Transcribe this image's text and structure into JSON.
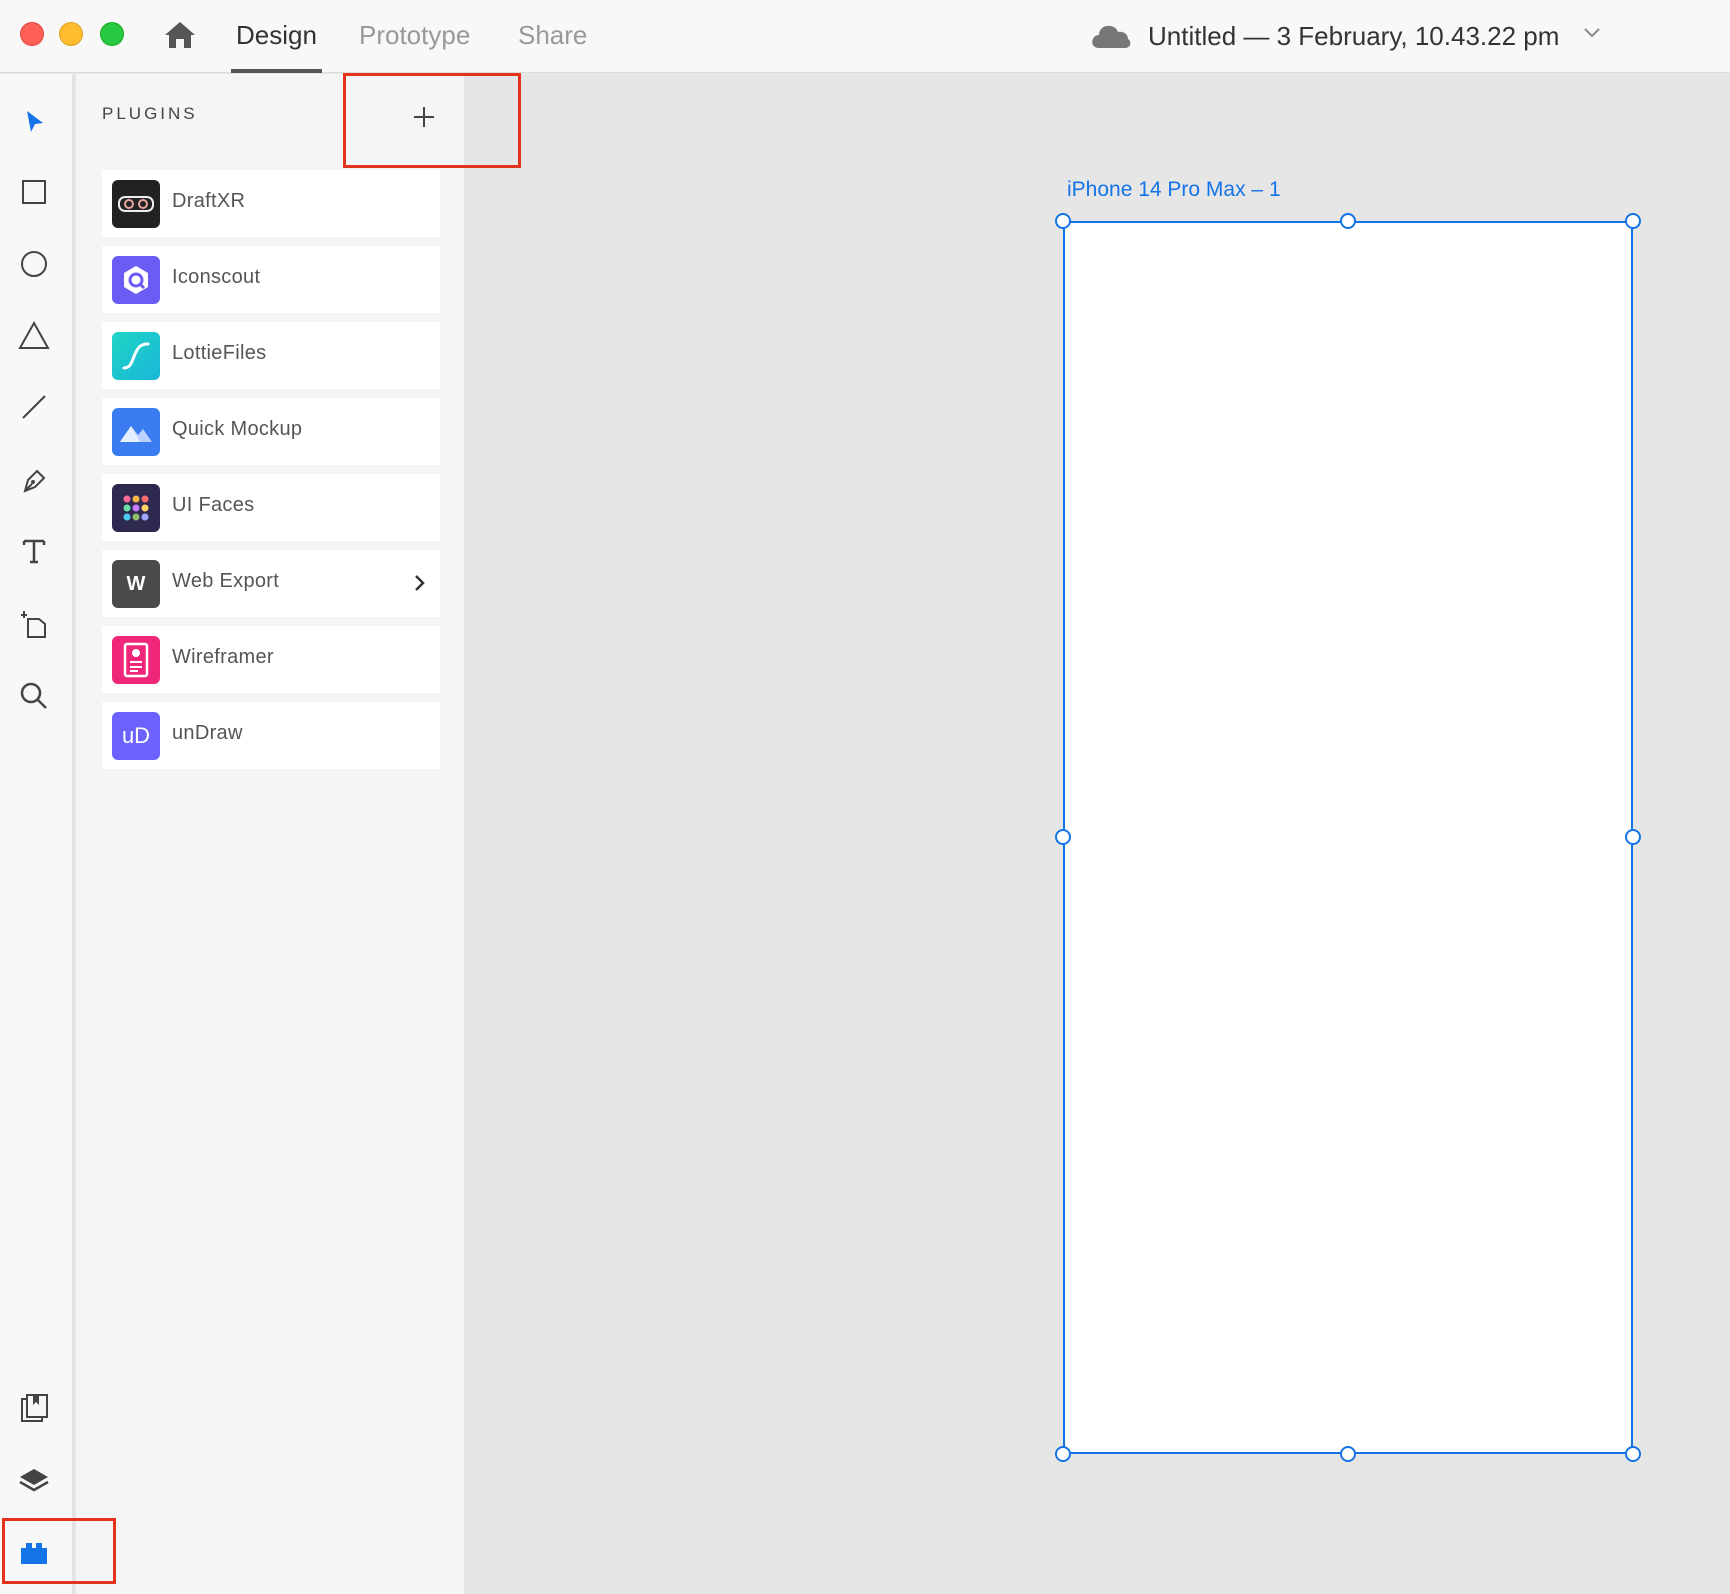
{
  "window": {
    "tabs": [
      "Design",
      "Prototype",
      "Share"
    ],
    "active_tab": "Design",
    "document_title": "Untitled — 3 February, 10.43.22 pm"
  },
  "toolbar": {
    "tools": [
      "select-icon",
      "rectangle-icon",
      "ellipse-icon",
      "polygon-icon",
      "line-icon",
      "pen-icon",
      "text-icon",
      "artboard-icon",
      "zoom-icon"
    ],
    "bottom_tools": [
      "assets-icon",
      "layers-icon",
      "plugins-icon"
    ],
    "active_bottom_tool": "plugins-icon",
    "accent_color": "#1473e6"
  },
  "plugins_panel": {
    "title": "PLUGINS",
    "add_label": "+",
    "items": [
      {
        "label": "DraftXR",
        "icon": "draftxr-icon",
        "icon_color": "#222222"
      },
      {
        "label": "Iconscout",
        "icon": "iconscout-icon",
        "icon_color": "#6b5cf6"
      },
      {
        "label": "LottieFiles",
        "icon": "lottiefiles-icon",
        "icon_color": "#1ecfc7"
      },
      {
        "label": "Quick Mockup",
        "icon": "quick-mockup-icon",
        "icon_color": "#3b7bf0"
      },
      {
        "label": "UI Faces",
        "icon": "ui-faces-icon",
        "icon_color": "#2e2a4f"
      },
      {
        "label": "Web Export",
        "icon": "web-export-icon",
        "icon_text": "W",
        "icon_color": "#4a4a4a",
        "has_submenu": true
      },
      {
        "label": "Wireframer",
        "icon": "wireframer-icon",
        "icon_color": "#f0267a"
      },
      {
        "label": "unDraw",
        "icon": "undraw-icon",
        "icon_text": "uD",
        "icon_color": "#6c63ff"
      }
    ]
  },
  "canvas": {
    "artboard_label": "iPhone 14 Pro Max – 1",
    "selection_color": "#1473e6"
  }
}
